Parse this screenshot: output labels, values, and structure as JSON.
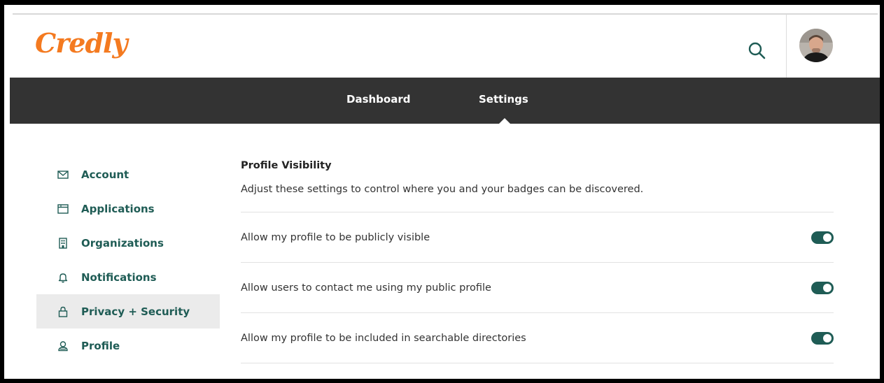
{
  "header": {
    "logo_text": "Credly",
    "logo_color": "#f47a20",
    "search_icon": "search-icon",
    "avatar_alt": "user-avatar"
  },
  "nav": {
    "links": [
      {
        "label": "Dashboard",
        "active": false
      },
      {
        "label": "Settings",
        "active": true
      }
    ],
    "background": "#333333"
  },
  "sidebar": {
    "items": [
      {
        "label": "Account",
        "icon": "envelope-icon",
        "active": false
      },
      {
        "label": "Applications",
        "icon": "window-icon",
        "active": false
      },
      {
        "label": "Organizations",
        "icon": "building-icon",
        "active": false
      },
      {
        "label": "Notifications",
        "icon": "bell-icon",
        "active": false
      },
      {
        "label": "Privacy + Security",
        "icon": "lock-icon",
        "active": true
      },
      {
        "label": "Profile",
        "icon": "badge-icon",
        "active": false
      }
    ],
    "accent": "#1f5c55"
  },
  "main": {
    "section_title": "Profile Visibility",
    "section_description": "Adjust these settings to control where you and your badges can be discovered.",
    "settings": [
      {
        "label": "Allow my profile to be publicly visible",
        "enabled": true
      },
      {
        "label": "Allow users to contact me using my public profile",
        "enabled": true
      },
      {
        "label": "Allow my profile to be included in searchable directories",
        "enabled": true
      }
    ]
  }
}
